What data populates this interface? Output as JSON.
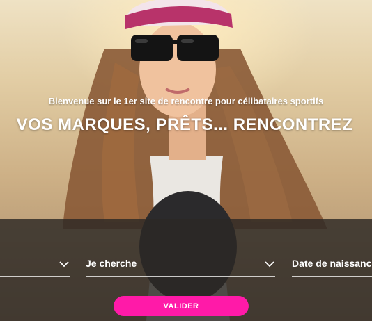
{
  "hero": {
    "tagline": "Bienvenue sur le 1er site de rencontre pour célibataires sportifs",
    "headline": "VOS MARQUES, PRÊTS... RENCONTREZ"
  },
  "search": {
    "field1_label": "",
    "field2_label": "Je cherche",
    "field3_label": "Date de naissance",
    "submit_label": "VALIDER"
  },
  "colors": {
    "accent": "#ff1aa8",
    "panel": "#2c2824"
  }
}
